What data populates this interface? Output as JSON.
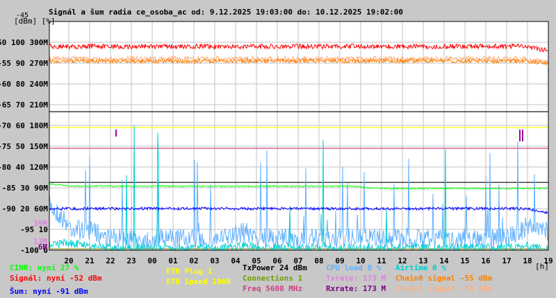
{
  "chart_data": {
    "type": "line",
    "title": "Signál a šum radia ce_osoba_ac od: 9.12.2025 19:03:00 do: 10.12.2025 19:02:00",
    "ylabel": "[dBm] [%]",
    "ytop_label": "-45",
    "xlabel": "[h]",
    "ylim": [
      -100,
      -45
    ],
    "y_ticks": [
      {
        "dbm": "-50",
        "pct": "100",
        "rate": "300M"
      },
      {
        "dbm": "-55",
        "pct": "90",
        "rate": "270M"
      },
      {
        "dbm": "-60",
        "pct": "80",
        "rate": "240M"
      },
      {
        "dbm": "-65",
        "pct": "70",
        "rate": "210M"
      },
      {
        "dbm": "-70",
        "pct": "60",
        "rate": "180M"
      },
      {
        "dbm": "-75",
        "pct": "50",
        "rate": "150M"
      },
      {
        "dbm": "-80",
        "pct": "40",
        "rate": "120M"
      },
      {
        "dbm": "-85",
        "pct": "30",
        "rate": "90M"
      },
      {
        "dbm": "-90",
        "pct": "20",
        "rate": "60M"
      },
      {
        "dbm": "-95",
        "pct": "10",
        "rate": ""
      },
      {
        "dbm": "-100",
        "pct": "0",
        "rate": ""
      }
    ],
    "rate_markers": [
      {
        "label": "39M",
        "color": "#e080e0"
      },
      {
        "label": "13M",
        "color": "#e080e0"
      },
      {
        "label": "6M",
        "color": "#800080"
      }
    ],
    "x_ticks": [
      "20",
      "21",
      "22",
      "23",
      "00",
      "01",
      "02",
      "03",
      "04",
      "05",
      "06",
      "07",
      "08",
      "09",
      "10",
      "11",
      "12",
      "13",
      "14",
      "15",
      "16",
      "17",
      "18",
      "19"
    ],
    "grid": true,
    "series": [
      {
        "name": "Signál",
        "color": "#ff0000",
        "unit": "dBm",
        "values": [
          -51,
          -51,
          -51,
          -51,
          -51,
          -51,
          -51,
          -51,
          -51,
          -51,
          -51,
          -51,
          -51,
          -51,
          -51,
          -51,
          -51,
          -51,
          -51,
          -51,
          -51,
          -51,
          -51,
          -52
        ]
      },
      {
        "name": "Chain0 signal",
        "color": "#ff8000",
        "unit": "dBm",
        "values": [
          -54.5,
          -54.5,
          -54.5,
          -54.5,
          -54.5,
          -54.5,
          -54.5,
          -54.5,
          -54.5,
          -54.5,
          -54.5,
          -54.5,
          -54.5,
          -54.5,
          -54.5,
          -54.5,
          -54.5,
          -54.5,
          -54.5,
          -54.5,
          -54.5,
          -54.5,
          -54.5,
          -55
        ]
      },
      {
        "name": "Chain1 signal",
        "color": "#ffb080",
        "unit": "dBm",
        "values": [
          -54,
          -54,
          -54,
          -54,
          -54,
          -54,
          -54,
          -54,
          -54,
          -54,
          -54,
          -54,
          -54,
          -54,
          -54,
          -54,
          -54,
          -54,
          -54,
          -54,
          -54,
          -54,
          -54,
          -55
        ]
      },
      {
        "name": "Šum",
        "color": "#0000ff",
        "unit": "dBm",
        "values": [
          -90,
          -90,
          -90,
          -90,
          -90,
          -90,
          -90,
          -90,
          -90,
          -90,
          -90,
          -90,
          -90,
          -90,
          -90,
          -90,
          -90,
          -90,
          -90,
          -90,
          -90,
          -90,
          -90,
          -91
        ]
      },
      {
        "name": "CINR",
        "color": "#00ff00",
        "unit": "%",
        "values": [
          29,
          28,
          28,
          28,
          28,
          28,
          28,
          28,
          28,
          28,
          28,
          28,
          28,
          28,
          28,
          27,
          27,
          27,
          27,
          27,
          27,
          27,
          27,
          27
        ]
      },
      {
        "name": "CPU load",
        "color": "#60b0ff",
        "unit": "%",
        "values": [
          20,
          10,
          8,
          5,
          5,
          5,
          5,
          5,
          5,
          8,
          5,
          5,
          5,
          5,
          5,
          5,
          5,
          5,
          5,
          5,
          5,
          5,
          10,
          8
        ]
      },
      {
        "name": "Airtime",
        "color": "#00d0d0",
        "unit": "%",
        "values": [
          3,
          3,
          2,
          1,
          1,
          1,
          1,
          1,
          1,
          2,
          1,
          1,
          1,
          1,
          1,
          1,
          1,
          1,
          1,
          1,
          1,
          1,
          2,
          0
        ]
      },
      {
        "name": "TxPower",
        "color": "#000000",
        "unit": "dBm",
        "values": [
          24,
          24,
          24,
          24,
          24,
          24,
          24,
          24,
          24,
          24,
          24,
          24,
          24,
          24,
          24,
          24,
          24,
          24,
          24,
          24,
          24,
          24,
          24,
          24
        ]
      }
    ],
    "hlines": [
      {
        "name": "txpower-line",
        "color": "#000000",
        "level": -66.7
      },
      {
        "name": "eth-speed-line",
        "color": "#ffff00",
        "level": -70.5
      },
      {
        "name": "freq-line",
        "color": "#d04080",
        "level": -75.5
      },
      {
        "name": "connections-line",
        "color": "#000000",
        "level": -83.7
      },
      {
        "name": "rate-line",
        "color": "#808000",
        "level": -99.7
      }
    ]
  },
  "legend": {
    "cinr": "CINR: nyní 27 %",
    "signal": "Signál: nyní -52 dBm",
    "noise": "Šum: nyní -91 dBm",
    "eth_plug": "ETH Plug 1",
    "eth_speed": "ETH Speed 1000",
    "txpower": "TxPower 24 dBm",
    "connections": "Connections 1",
    "freq": "Freq 5600 MHz",
    "cpu": "CPU load 8 %",
    "txrate": "Txrate: 173 M",
    "rxrate": "Rxrate: 173 M",
    "airtime": "Airtime 0 %",
    "chain0": "Chain0 signal -55 dBm",
    "chain1": "Chain1 signal -55 dBm"
  },
  "colors": {
    "cinr": "#00ff00",
    "signal": "#ff0000",
    "noise": "#0000ff",
    "eth": "#ffff00",
    "txpower": "#000000",
    "connections": "#70a000",
    "freq": "#d04080",
    "cpu": "#60b0ff",
    "txrate": "#e080e0",
    "rxrate": "#800080",
    "airtime": "#00d0d0",
    "chain0": "#ff8000",
    "chain1": "#ffb080"
  }
}
